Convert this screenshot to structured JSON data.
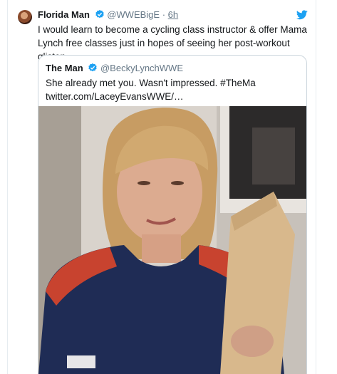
{
  "tweet": {
    "author_name": "Florida Man",
    "author_handle": "@WWEBigE",
    "separator": "·",
    "time": "6h",
    "text": "I would learn to become a cycling class instructor & offer Mama Lynch free classes just in hopes of seeing her post-workout glisten.",
    "verified_icon": "verified-badge-icon",
    "platform_icon": "twitter-bird-icon"
  },
  "quoted": {
    "author_name": "The Man",
    "author_handle": "@BeckyLynchWWE",
    "line1": "She already met you. Wasn't impressed. #TheMa",
    "line2": "twitter.com/LaceyEvansWWE/…",
    "verified_icon": "verified-badge-icon"
  },
  "colors": {
    "verified": "#1da1f2",
    "link": "#14171a",
    "muted": "#657786",
    "border": "#ccd6dd"
  }
}
